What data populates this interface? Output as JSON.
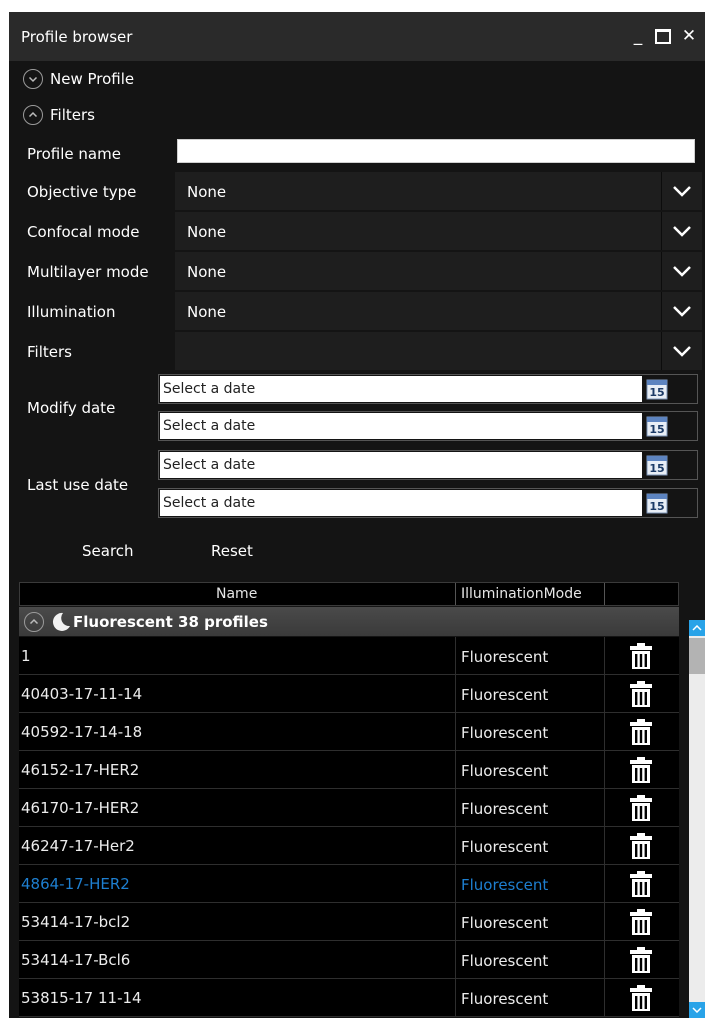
{
  "window": {
    "title": "Profile browser"
  },
  "sections": {
    "new_profile": "New Profile",
    "filters": "Filters"
  },
  "filters": {
    "profile_name_label": "Profile name",
    "profile_name_value": "",
    "objective_type_label": "Objective type",
    "objective_type_value": "None",
    "confocal_mode_label": "Confocal mode",
    "confocal_mode_value": "None",
    "multilayer_mode_label": "Multilayer mode",
    "multilayer_mode_value": "None",
    "illumination_label": "Illumination",
    "illumination_value": "None",
    "filters_label": "Filters",
    "filters_value": "",
    "modify_date_label": "Modify date",
    "last_use_date_label": "Last use date",
    "date_placeholder": "Select a date",
    "calendar_day": "15"
  },
  "actions": {
    "search": "Search",
    "reset": "Reset"
  },
  "grid": {
    "columns": [
      "Name",
      "IlluminationMode"
    ],
    "group_label": "Fluorescent 38 profiles",
    "rows": [
      {
        "name": "1",
        "mode": "Fluorescent",
        "selected": false
      },
      {
        "name": "40403-17-11-14",
        "mode": "Fluorescent",
        "selected": false
      },
      {
        "name": "40592-17-14-18",
        "mode": "Fluorescent",
        "selected": false
      },
      {
        "name": "46152-17-HER2",
        "mode": "Fluorescent",
        "selected": false
      },
      {
        "name": "46170-17-HER2",
        "mode": "Fluorescent",
        "selected": false
      },
      {
        "name": "46247-17-Her2",
        "mode": "Fluorescent",
        "selected": false
      },
      {
        "name": "4864-17-HER2",
        "mode": "Fluorescent",
        "selected": true
      },
      {
        "name": "53414-17-bcl2",
        "mode": "Fluorescent",
        "selected": false
      },
      {
        "name": "53414-17-Bcl6",
        "mode": "Fluorescent",
        "selected": false
      },
      {
        "name": "53815-17  11-14",
        "mode": "Fluorescent",
        "selected": false
      }
    ]
  },
  "colors": {
    "selected_text": "#1e7fd0",
    "scrollbar_accent": "#29a3e8"
  }
}
